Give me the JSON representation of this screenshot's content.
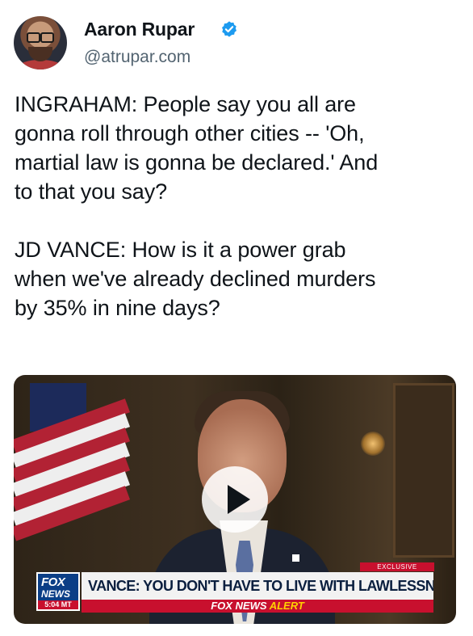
{
  "author": {
    "name": "Aaron Rupar",
    "handle": "@atrupar.com",
    "verified": true
  },
  "tweet": {
    "text": "INGRAHAM: People say you all are\ngonna roll through other cities -- 'Oh,\nmartial law is gonna be declared.' And\nto that you say?\n\nJD VANCE: How is it a power grab\nwhen we've already declined murders\nby 35% in nine days?"
  },
  "video": {
    "play_icon": "play-icon",
    "logo_fox": "FOX",
    "logo_news": "NEWS",
    "logo_time": "5:04 MT",
    "exclusive_tag": "EXCLUSIVE",
    "chyron": "VANCE: YOU DON'T HAVE TO LIVE WITH LAWLESSNESS",
    "alert_brand": "FOX NEWS",
    "alert_word": "ALERT"
  },
  "colors": {
    "verified_blue": "#1d9bf0",
    "fox_red": "#c8102e",
    "fox_blue": "#0b3e86",
    "handle_gray": "#536471"
  }
}
